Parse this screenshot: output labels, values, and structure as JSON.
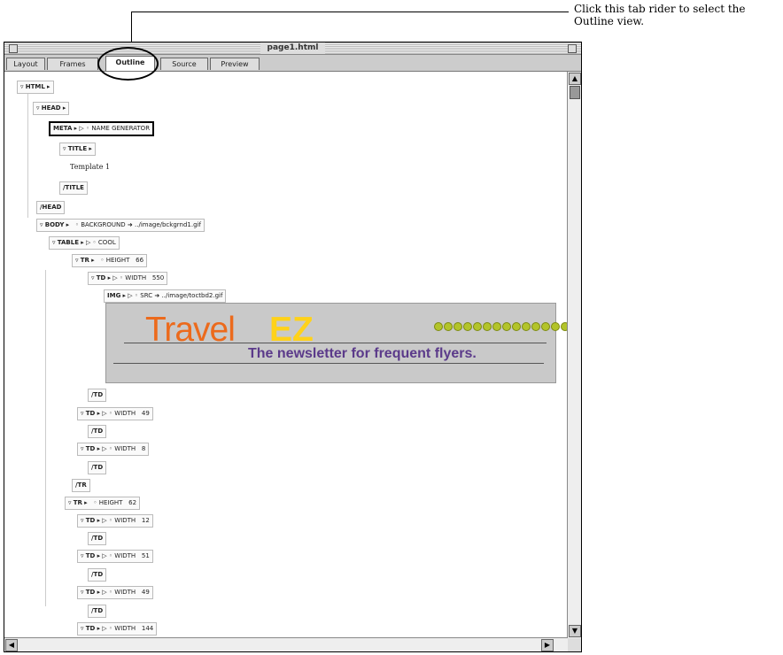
{
  "callout": {
    "text": "Click this tab rider to select the Outline view."
  },
  "window": {
    "title": "page1.html"
  },
  "tabs": [
    {
      "label": "Layout"
    },
    {
      "label": "Frames"
    },
    {
      "label": "Outline"
    },
    {
      "label": "Source"
    },
    {
      "label": "Preview"
    }
  ],
  "outline": {
    "html": "HTML",
    "head": "HEAD",
    "meta": {
      "tag": "META",
      "attr": "NAME",
      "value": "GENERATOR"
    },
    "title": "TITLE",
    "title_text": "Template 1",
    "title_close": "/TITLE",
    "head_close": "/HEAD",
    "body": {
      "tag": "BODY",
      "attr": "BACKGROUND",
      "value": "../image/bckgrnd1.gif"
    },
    "table": {
      "tag": "TABLE",
      "attr": "COOL"
    },
    "tr1": {
      "tag": "TR",
      "attr": "HEIGHT",
      "value": "66"
    },
    "td1": {
      "tag": "TD",
      "attr": "WIDTH",
      "value": "550"
    },
    "img": {
      "tag": "IMG",
      "attr": "SRC",
      "value": "../image/toctbd2.gif"
    },
    "banner": {
      "travel": "Travel",
      "ez": "EZ",
      "slogan": "The newsletter for frequent flyers."
    },
    "td_close": "/TD",
    "td2": {
      "tag": "TD",
      "attr": "WIDTH",
      "value": "49"
    },
    "td3": {
      "tag": "TD",
      "attr": "WIDTH",
      "value": "8"
    },
    "tr_close": "/TR",
    "tr2": {
      "tag": "TR",
      "attr": "HEIGHT",
      "value": "62"
    },
    "td4": {
      "tag": "TD",
      "attr": "WIDTH",
      "value": "12"
    },
    "td5": {
      "tag": "TD",
      "attr": "WIDTH",
      "value": "51"
    },
    "td6": {
      "tag": "TD",
      "attr": "WIDTH",
      "value": "49"
    },
    "td7": {
      "tag": "TD",
      "attr": "WIDTH",
      "value": "144"
    }
  }
}
